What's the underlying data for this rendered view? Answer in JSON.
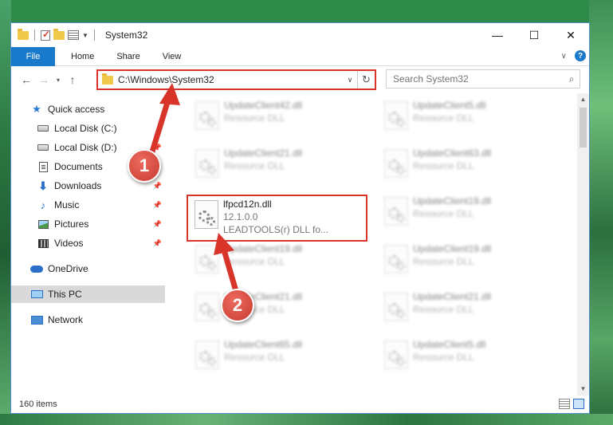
{
  "window": {
    "title": "System32",
    "controls": {
      "minimize": "—",
      "maximize": "☐",
      "close": "✕"
    }
  },
  "ribbon": {
    "file_tab": "File",
    "tabs": [
      "Home",
      "Share",
      "View"
    ]
  },
  "address": {
    "path": "C:\\Windows\\System32",
    "search_placeholder": "Search System32"
  },
  "nav": {
    "items": [
      {
        "label": "Quick access",
        "icon": "star-icon"
      },
      {
        "label": "Local Disk (C:)",
        "icon": "drive-icon"
      },
      {
        "label": "Local Disk (D:)",
        "icon": "drive-icon",
        "pinned": true
      },
      {
        "label": "Documents",
        "icon": "documents-icon",
        "pinned": true
      },
      {
        "label": "Downloads",
        "icon": "downloads-icon",
        "pinned": true
      },
      {
        "label": "Music",
        "icon": "music-icon",
        "pinned": true
      },
      {
        "label": "Pictures",
        "icon": "pictures-icon",
        "pinned": true
      },
      {
        "label": "Videos",
        "icon": "videos-icon",
        "pinned": true
      },
      {
        "label": "OneDrive",
        "icon": "onedrive-icon"
      },
      {
        "label": "This PC",
        "icon": "this-pc-icon",
        "selected": true
      },
      {
        "label": "Network",
        "icon": "network-icon"
      }
    ]
  },
  "files": {
    "left": [
      {
        "name": "UpdateClient42.dll",
        "desc": "Resource DLL"
      },
      {
        "name": "UpdateClient21.dll",
        "desc": "Resource DLL"
      },
      {
        "name": "lfpcd12n.dll",
        "version": "12.1.0.0",
        "desc": "LEADTOOLS(r) DLL fo..."
      },
      {
        "name": "UpdateClient19.dll",
        "desc": "Resource DLL"
      },
      {
        "name": "UpdateClient21.dll",
        "desc": "Resource DLL"
      },
      {
        "name": "UpdateClient65.dll",
        "desc": "Resource DLL"
      }
    ],
    "right": [
      {
        "name": "UpdateClient5.dll",
        "desc": "Resource DLL"
      },
      {
        "name": "UpdateClient63.dll",
        "desc": "Resource DLL"
      },
      {
        "name": "UpdateClient19.dll",
        "desc": "Resource DLL"
      },
      {
        "name": "UpdateClient19.dll",
        "desc": "Resource DLL"
      },
      {
        "name": "UpdateClient21.dll",
        "desc": "Resource DLL"
      },
      {
        "name": "UpdateClient5.dll",
        "desc": "Resource DLL"
      }
    ]
  },
  "status": {
    "item_count": "160 items"
  },
  "callouts": {
    "step1": "1",
    "step2": "2"
  },
  "colors": {
    "accent": "#1979ca",
    "highlight": "#d9342a"
  }
}
